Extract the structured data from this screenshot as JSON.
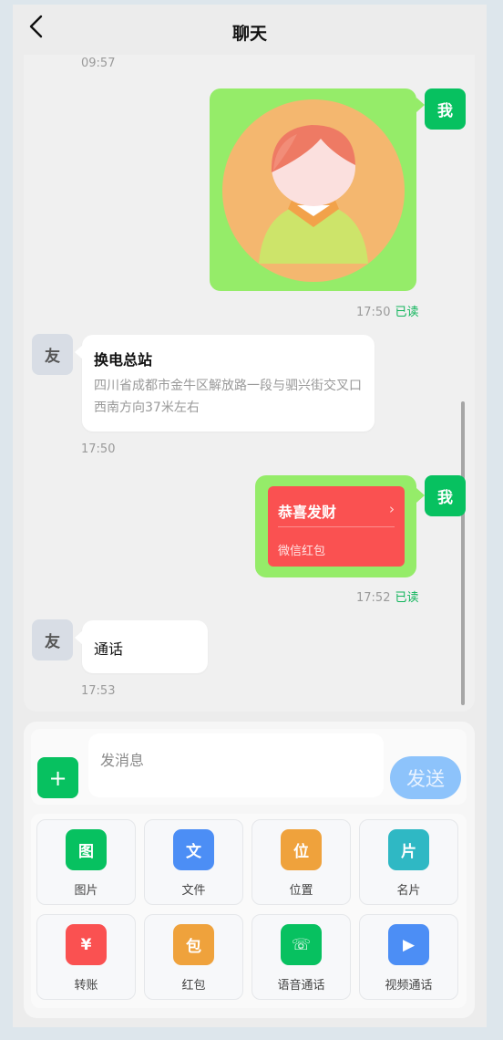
{
  "header": {
    "title": "聊天"
  },
  "messages": {
    "m0": {
      "time": "09:57"
    },
    "m1": {
      "sender": "我",
      "type": "image",
      "time": "17:50",
      "status": "已读"
    },
    "m2": {
      "sender": "友",
      "type": "location",
      "title": "换电总站",
      "address": "四川省成都市金牛区解放路一段与驷兴街交叉口西南方向37米左右",
      "time": "17:50"
    },
    "m3": {
      "sender": "我",
      "type": "red-packet",
      "title": "恭喜发财",
      "chevron": "›",
      "subtitle": "微信红包",
      "time": "17:52",
      "status": "已读"
    },
    "m4": {
      "sender": "友",
      "type": "call",
      "text": "通话",
      "time": "17:53"
    }
  },
  "composer": {
    "plus": "+",
    "placeholder": "发消息",
    "send_label": "发送"
  },
  "tools": {
    "t0": {
      "icon": "图",
      "label": "图片",
      "color": "#07c160"
    },
    "t1": {
      "icon": "文",
      "label": "文件",
      "color": "#4c8ef5"
    },
    "t2": {
      "icon": "位",
      "label": "位置",
      "color": "#efa23c"
    },
    "t3": {
      "icon": "片",
      "label": "名片",
      "color": "#2fb8c4"
    },
    "t4": {
      "icon": "¥",
      "label": "转账",
      "color": "#fa5151"
    },
    "t5": {
      "icon": "包",
      "label": "红包",
      "color": "#efa23c"
    },
    "t6": {
      "icon": "☏",
      "label": "语音通话",
      "color": "#07c160"
    },
    "t7": {
      "icon": "▶",
      "label": "视频通话",
      "color": "#4c8ef5"
    }
  },
  "colors": {
    "accent": "#07c160",
    "bubble_self": "#95ec69",
    "red_packet": "#fa5151",
    "send": "#8dc3fb"
  }
}
